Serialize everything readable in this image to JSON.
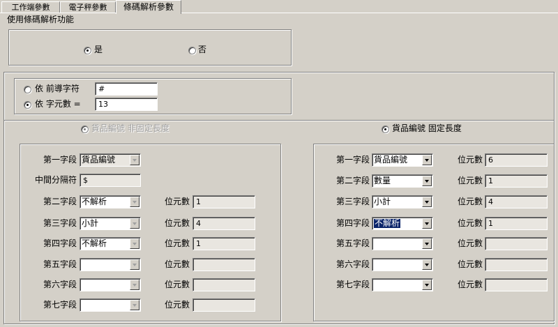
{
  "tabs": [
    {
      "label": "工作端參數",
      "active": false
    },
    {
      "label": "電子秤參數",
      "active": false
    },
    {
      "label": "條碼解析參數",
      "active": true
    }
  ],
  "enable_group": {
    "title": "使用條碼解析功能",
    "yes_label": "是",
    "no_label": "否",
    "selected": "yes"
  },
  "mode_group": {
    "by_prefix_label": "依  前導字符",
    "prefix_value": "#",
    "by_length_label": "依  字元數  =",
    "length_value": "13",
    "selected": "by_length"
  },
  "left_panel": {
    "radio_label": "貨品編號  非固定長度",
    "selected": false,
    "disabled": true,
    "field1_label": "第一字段",
    "field1_value": "貨品編號",
    "separator_label": "中間分隔符",
    "separator_value": "$",
    "digits_label": "位元數",
    "rows": [
      {
        "label": "第二字段",
        "value": "不解析",
        "digits": "1"
      },
      {
        "label": "第三字段",
        "value": "小計",
        "digits": "4"
      },
      {
        "label": "第四字段",
        "value": "不解析",
        "digits": "1"
      },
      {
        "label": "第五字段",
        "value": "",
        "digits": ""
      },
      {
        "label": "第六字段",
        "value": "",
        "digits": ""
      },
      {
        "label": "第七字段",
        "value": "",
        "digits": ""
      }
    ]
  },
  "right_panel": {
    "radio_label": "貨品編號  固定長度",
    "selected": true,
    "digits_label": "位元數",
    "rows": [
      {
        "label": "第一字段",
        "value": "貨品編號",
        "digits": "6"
      },
      {
        "label": "第二字段",
        "value": "數量",
        "digits": "1"
      },
      {
        "label": "第三字段",
        "value": "小計",
        "digits": "4"
      },
      {
        "label": "第四字段",
        "value": "不解析",
        "digits": "1",
        "highlighted": true
      },
      {
        "label": "第五字段",
        "value": "",
        "digits": ""
      },
      {
        "label": "第六字段",
        "value": "",
        "digits": ""
      },
      {
        "label": "第七字段",
        "value": "",
        "digits": ""
      }
    ]
  }
}
